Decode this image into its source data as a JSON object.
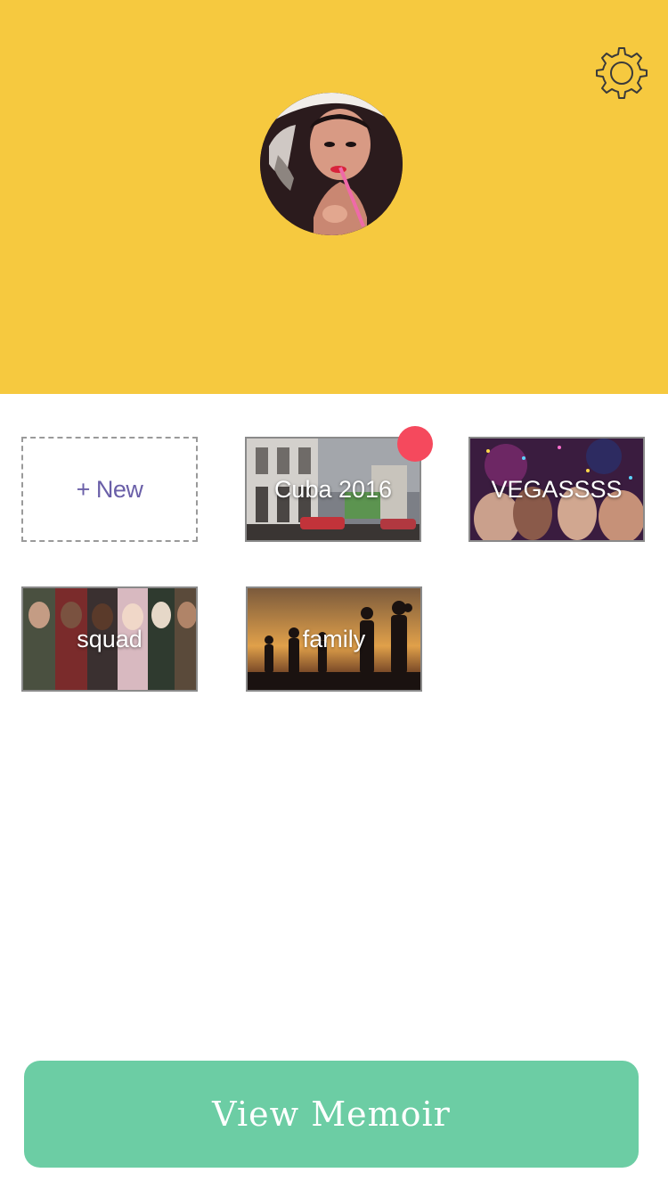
{
  "header": {
    "background_color": "#f6c93f",
    "settings_icon": "gear-icon",
    "avatar": "profile-photo"
  },
  "albums": {
    "new_label": "+ New",
    "items": [
      {
        "label": "Cuba 2016",
        "has_notification": true
      },
      {
        "label": "VEGASSSS",
        "has_notification": false
      },
      {
        "label": "squad",
        "has_notification": false
      },
      {
        "label": "family",
        "has_notification": false
      }
    ],
    "notification_color": "#f5495d",
    "new_label_color": "#6a5fa8"
  },
  "footer": {
    "view_memoir_label": "View Memoir",
    "button_color": "#6ccda4"
  }
}
